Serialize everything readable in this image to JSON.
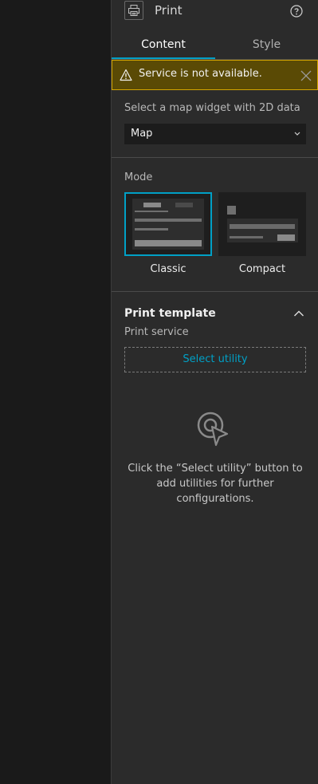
{
  "header": {
    "title": "Print",
    "widget_icon": "printer-icon",
    "help_icon": "question-circle-icon"
  },
  "tabs": [
    {
      "label": "Content",
      "active": true
    },
    {
      "label": "Style",
      "active": false
    }
  ],
  "alert": {
    "message": "Service is not available.",
    "icon": "warning-triangle-icon",
    "close_icon": "close-icon",
    "colors": {
      "background": "#5a4a05",
      "border": "#d4a500"
    }
  },
  "map_widget": {
    "label": "Select a map widget with 2D data",
    "selected": "Map"
  },
  "mode": {
    "label": "Mode",
    "options": [
      {
        "label": "Classic",
        "selected": true
      },
      {
        "label": "Compact",
        "selected": false
      }
    ]
  },
  "print_template": {
    "title": "Print template",
    "service_label": "Print service",
    "select_button": "Select utility",
    "empty_icon": "select-cursor-icon",
    "empty_message": "Click the “Select utility” button to add utilities for further configurations."
  },
  "colors": {
    "accent": "#00a0c6",
    "panel_bg": "#2b2b2b",
    "canvas_bg": "#1a1a1a"
  }
}
